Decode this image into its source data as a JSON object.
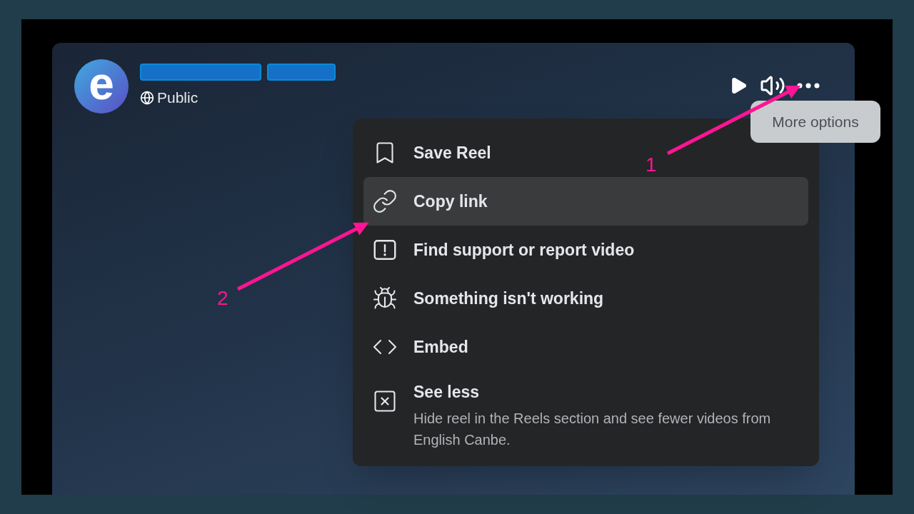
{
  "avatar": {
    "letter": "e"
  },
  "visibility": "Public",
  "controls": [
    {
      "kind": "play"
    },
    {
      "kind": "volume"
    },
    {
      "kind": "more"
    }
  ],
  "tooltip": "More options",
  "menu": {
    "items": [
      {
        "kind": "bookmark",
        "label": "Save Reel",
        "selected": false
      },
      {
        "kind": "link",
        "label": "Copy link",
        "selected": true
      },
      {
        "kind": "report",
        "label": "Find support or report video",
        "selected": false
      },
      {
        "kind": "bug",
        "label": "Something isn't working",
        "selected": false
      },
      {
        "kind": "code",
        "label": "Embed",
        "selected": false
      },
      {
        "kind": "close",
        "label": "See less",
        "description": "Hide reel in the Reels section and see fewer videos from English Canbe.",
        "selected": false
      }
    ]
  },
  "annotations": [
    {
      "label": "1"
    },
    {
      "label": "2"
    }
  ]
}
